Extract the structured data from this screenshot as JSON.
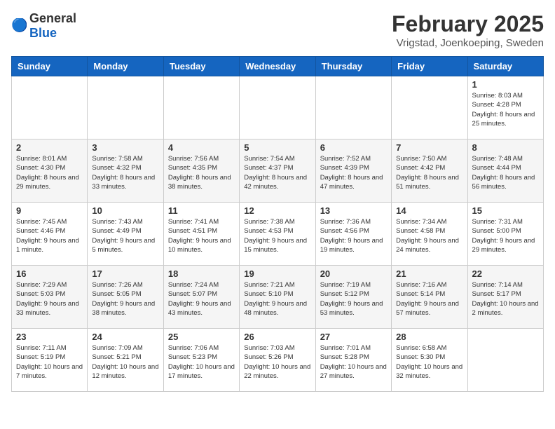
{
  "header": {
    "logo_general": "General",
    "logo_blue": "Blue",
    "month_year": "February 2025",
    "location": "Vrigstad, Joenkoeping, Sweden"
  },
  "days_of_week": [
    "Sunday",
    "Monday",
    "Tuesday",
    "Wednesday",
    "Thursday",
    "Friday",
    "Saturday"
  ],
  "weeks": [
    [
      {
        "day": "",
        "info": ""
      },
      {
        "day": "",
        "info": ""
      },
      {
        "day": "",
        "info": ""
      },
      {
        "day": "",
        "info": ""
      },
      {
        "day": "",
        "info": ""
      },
      {
        "day": "",
        "info": ""
      },
      {
        "day": "1",
        "info": "Sunrise: 8:03 AM\nSunset: 4:28 PM\nDaylight: 8 hours and 25 minutes."
      }
    ],
    [
      {
        "day": "2",
        "info": "Sunrise: 8:01 AM\nSunset: 4:30 PM\nDaylight: 8 hours and 29 minutes."
      },
      {
        "day": "3",
        "info": "Sunrise: 7:58 AM\nSunset: 4:32 PM\nDaylight: 8 hours and 33 minutes."
      },
      {
        "day": "4",
        "info": "Sunrise: 7:56 AM\nSunset: 4:35 PM\nDaylight: 8 hours and 38 minutes."
      },
      {
        "day": "5",
        "info": "Sunrise: 7:54 AM\nSunset: 4:37 PM\nDaylight: 8 hours and 42 minutes."
      },
      {
        "day": "6",
        "info": "Sunrise: 7:52 AM\nSunset: 4:39 PM\nDaylight: 8 hours and 47 minutes."
      },
      {
        "day": "7",
        "info": "Sunrise: 7:50 AM\nSunset: 4:42 PM\nDaylight: 8 hours and 51 minutes."
      },
      {
        "day": "8",
        "info": "Sunrise: 7:48 AM\nSunset: 4:44 PM\nDaylight: 8 hours and 56 minutes."
      }
    ],
    [
      {
        "day": "9",
        "info": "Sunrise: 7:45 AM\nSunset: 4:46 PM\nDaylight: 9 hours and 1 minute."
      },
      {
        "day": "10",
        "info": "Sunrise: 7:43 AM\nSunset: 4:49 PM\nDaylight: 9 hours and 5 minutes."
      },
      {
        "day": "11",
        "info": "Sunrise: 7:41 AM\nSunset: 4:51 PM\nDaylight: 9 hours and 10 minutes."
      },
      {
        "day": "12",
        "info": "Sunrise: 7:38 AM\nSunset: 4:53 PM\nDaylight: 9 hours and 15 minutes."
      },
      {
        "day": "13",
        "info": "Sunrise: 7:36 AM\nSunset: 4:56 PM\nDaylight: 9 hours and 19 minutes."
      },
      {
        "day": "14",
        "info": "Sunrise: 7:34 AM\nSunset: 4:58 PM\nDaylight: 9 hours and 24 minutes."
      },
      {
        "day": "15",
        "info": "Sunrise: 7:31 AM\nSunset: 5:00 PM\nDaylight: 9 hours and 29 minutes."
      }
    ],
    [
      {
        "day": "16",
        "info": "Sunrise: 7:29 AM\nSunset: 5:03 PM\nDaylight: 9 hours and 33 minutes."
      },
      {
        "day": "17",
        "info": "Sunrise: 7:26 AM\nSunset: 5:05 PM\nDaylight: 9 hours and 38 minutes."
      },
      {
        "day": "18",
        "info": "Sunrise: 7:24 AM\nSunset: 5:07 PM\nDaylight: 9 hours and 43 minutes."
      },
      {
        "day": "19",
        "info": "Sunrise: 7:21 AM\nSunset: 5:10 PM\nDaylight: 9 hours and 48 minutes."
      },
      {
        "day": "20",
        "info": "Sunrise: 7:19 AM\nSunset: 5:12 PM\nDaylight: 9 hours and 53 minutes."
      },
      {
        "day": "21",
        "info": "Sunrise: 7:16 AM\nSunset: 5:14 PM\nDaylight: 9 hours and 57 minutes."
      },
      {
        "day": "22",
        "info": "Sunrise: 7:14 AM\nSunset: 5:17 PM\nDaylight: 10 hours and 2 minutes."
      }
    ],
    [
      {
        "day": "23",
        "info": "Sunrise: 7:11 AM\nSunset: 5:19 PM\nDaylight: 10 hours and 7 minutes."
      },
      {
        "day": "24",
        "info": "Sunrise: 7:09 AM\nSunset: 5:21 PM\nDaylight: 10 hours and 12 minutes."
      },
      {
        "day": "25",
        "info": "Sunrise: 7:06 AM\nSunset: 5:23 PM\nDaylight: 10 hours and 17 minutes."
      },
      {
        "day": "26",
        "info": "Sunrise: 7:03 AM\nSunset: 5:26 PM\nDaylight: 10 hours and 22 minutes."
      },
      {
        "day": "27",
        "info": "Sunrise: 7:01 AM\nSunset: 5:28 PM\nDaylight: 10 hours and 27 minutes."
      },
      {
        "day": "28",
        "info": "Sunrise: 6:58 AM\nSunset: 5:30 PM\nDaylight: 10 hours and 32 minutes."
      },
      {
        "day": "",
        "info": ""
      }
    ]
  ]
}
